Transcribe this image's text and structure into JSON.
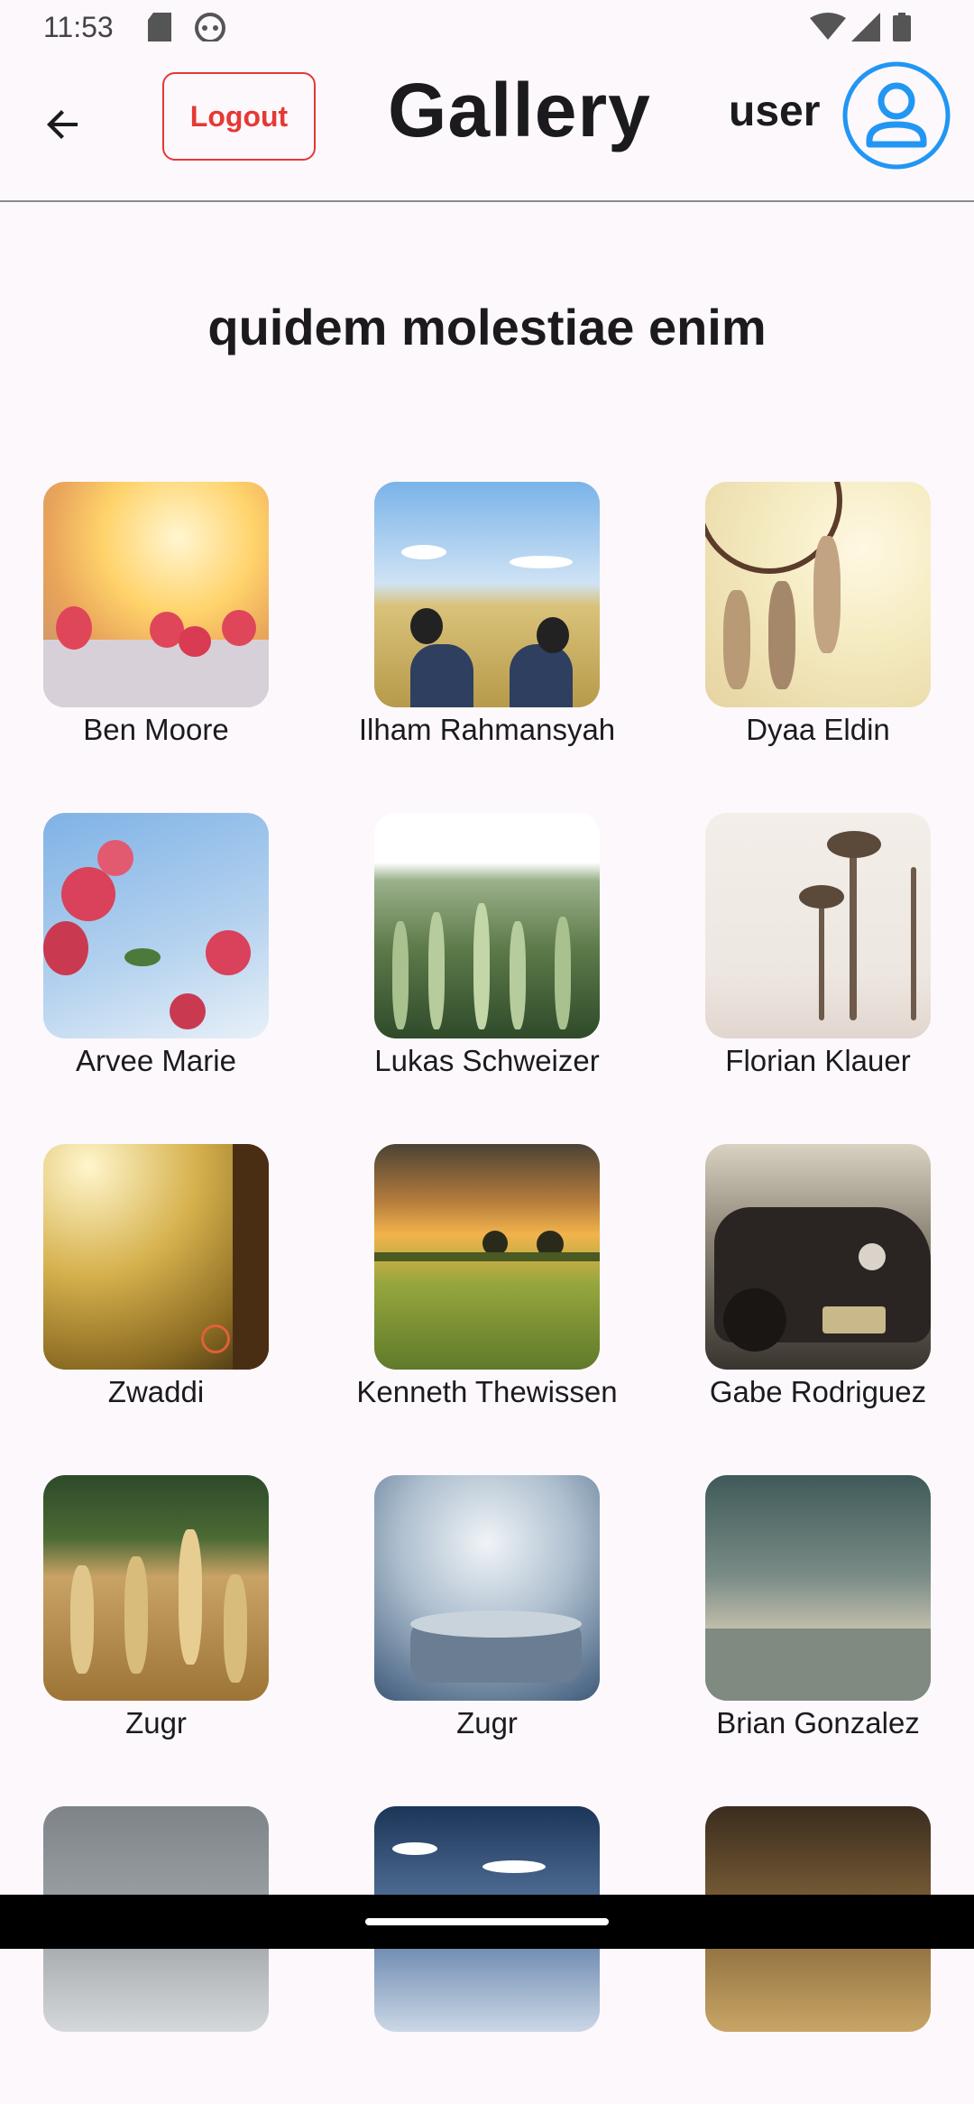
{
  "status_bar": {
    "time": "11:53"
  },
  "app_bar": {
    "logout_label": "Logout",
    "title": "Gallery",
    "user_label": "user"
  },
  "album": {
    "title": "quidem molestiae enim"
  },
  "photos": [
    {
      "author": "Ben Moore"
    },
    {
      "author": "Ilham Rahmansyah"
    },
    {
      "author": "Dyaa Eldin"
    },
    {
      "author": "Arvee Marie"
    },
    {
      "author": "Lukas Schweizer"
    },
    {
      "author": "Florian Klauer"
    },
    {
      "author": "Zwaddi"
    },
    {
      "author": "Kenneth Thewissen"
    },
    {
      "author": "Gabe Rodriguez"
    },
    {
      "author": "Zugr"
    },
    {
      "author": "Zugr"
    },
    {
      "author": "Brian Gonzalez"
    },
    {
      "author": ""
    },
    {
      "author": ""
    },
    {
      "author": ""
    }
  ],
  "colors": {
    "background": "#fdf8fc",
    "logout_accent": "#e53935",
    "avatar_accent": "#2196f3"
  },
  "icons": {
    "back": "arrow-left-icon",
    "avatar": "account-circle-icon",
    "wifi": "wifi-icon",
    "signal": "signal-icon",
    "battery": "battery-icon",
    "sd_card": "sd-card-icon",
    "notification": "android-robot-icon"
  }
}
